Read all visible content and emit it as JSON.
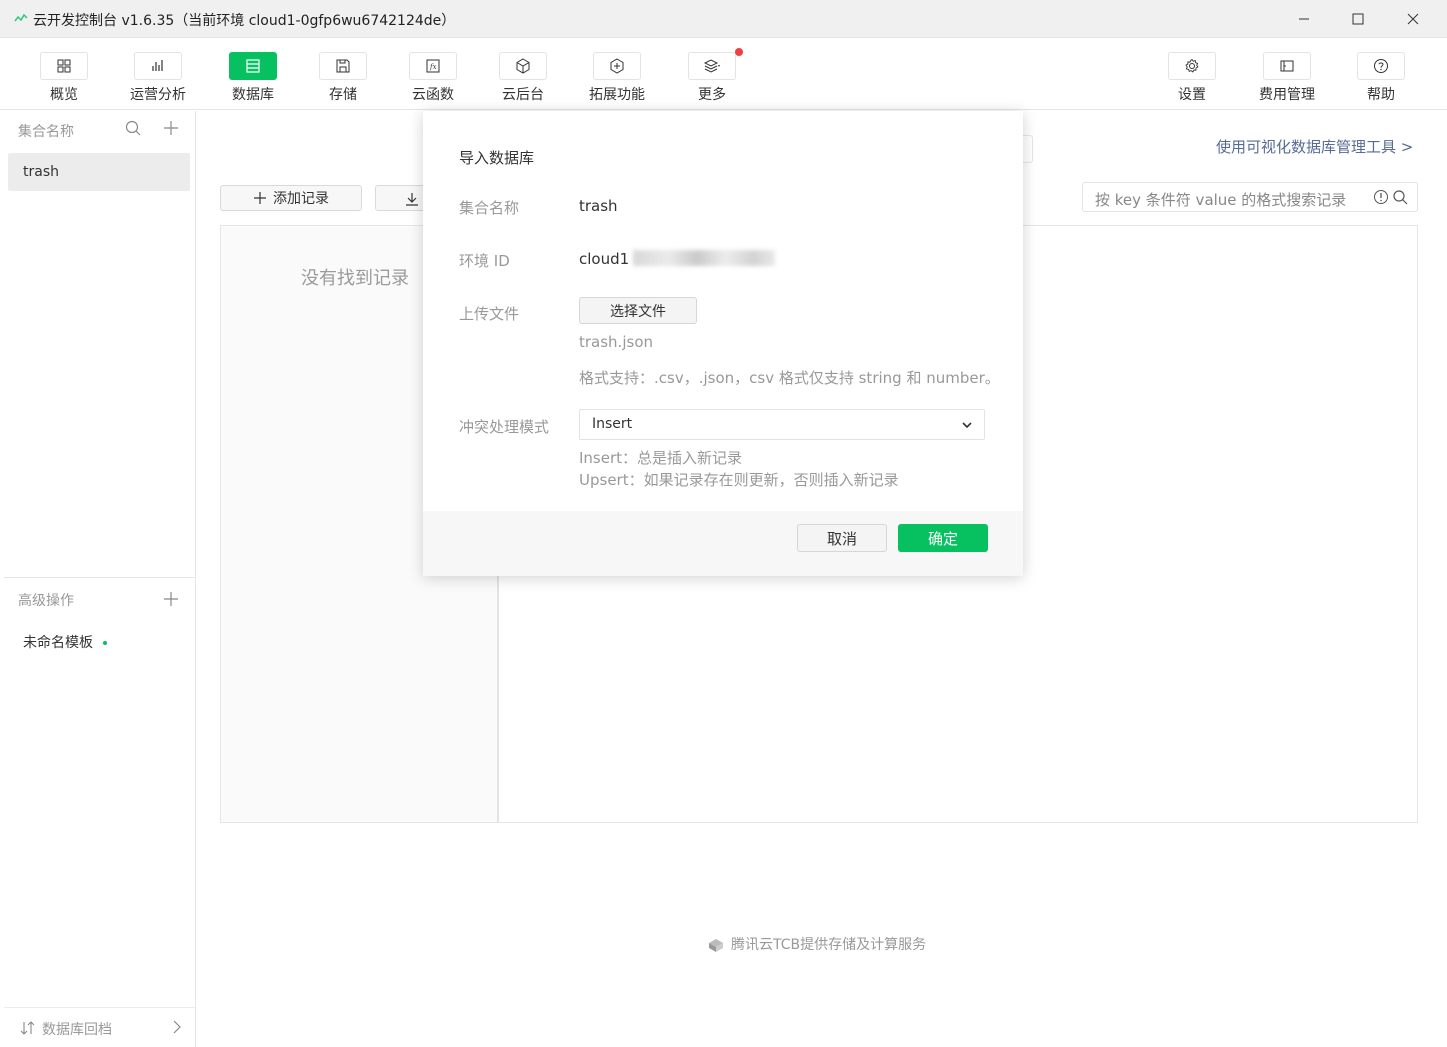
{
  "window": {
    "title": "云开发控制台 v1.6.35（当前环境 cloud1-0gfp6wu6742124de）"
  },
  "toolbar": {
    "items": [
      {
        "label": "概览",
        "icon": "grid-icon"
      },
      {
        "label": "运营分析",
        "icon": "bar-chart-icon"
      },
      {
        "label": "数据库",
        "icon": "database-icon",
        "active": true
      },
      {
        "label": "存储",
        "icon": "save-icon"
      },
      {
        "label": "云函数",
        "icon": "function-icon"
      },
      {
        "label": "云后台",
        "icon": "cube-icon"
      },
      {
        "label": "拓展功能",
        "icon": "plus-hexagon-icon"
      },
      {
        "label": "更多",
        "icon": "layers-icon",
        "badge": true
      }
    ],
    "right_items": [
      {
        "label": "设置",
        "icon": "gear-icon"
      },
      {
        "label": "费用管理",
        "icon": "billing-icon"
      },
      {
        "label": "帮助",
        "icon": "help-icon"
      }
    ]
  },
  "sidebar": {
    "collections_header": "集合名称",
    "collections": [
      "trash"
    ],
    "advanced_header": "高级操作",
    "template_name": "未命名模板",
    "footer_label": "数据库回档"
  },
  "main": {
    "visual_tool_link": "使用可视化数据库管理工具 >",
    "add_record_label": "添加记录",
    "search_placeholder": "按 key 条件符 value 的格式搜索记录",
    "empty_text": "没有找到记录",
    "footer_note": "腾讯云TCB提供存储及计算服务"
  },
  "dialog": {
    "title": "导入数据库",
    "collection_label": "集合名称",
    "collection_value": "trash",
    "env_label": "环境 ID",
    "env_value": "cloud1",
    "upload_label": "上传文件",
    "choose_file_label": "选择文件",
    "file_name": "trash.json",
    "format_hint": "格式支持：.csv，.json，csv 格式仅支持 string 和 number。",
    "conflict_label": "冲突处理模式",
    "conflict_value": "Insert",
    "insert_hint": "Insert：总是插入新记录",
    "upsert_hint": "Upsert：如果记录存在则更新，否则插入新记录",
    "cancel_label": "取消",
    "ok_label": "确定"
  },
  "colors": {
    "accent": "#07c160",
    "link": "#576b95",
    "badge": "#f43f3f"
  }
}
